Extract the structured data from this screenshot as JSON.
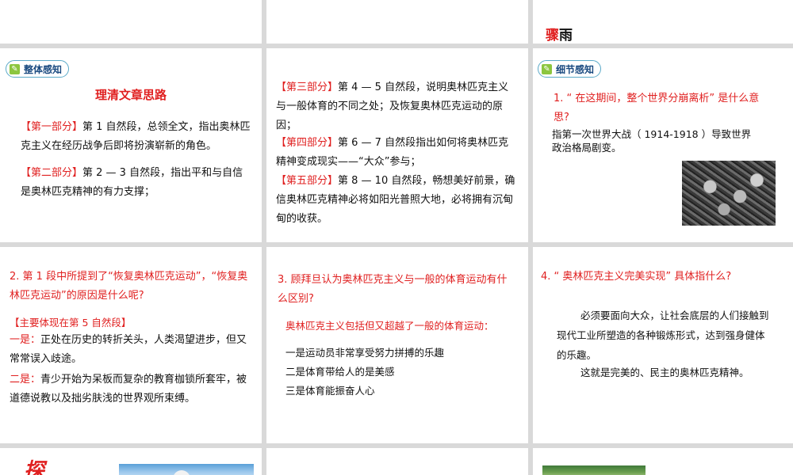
{
  "top": {
    "right_title_red": "骤",
    "right_title_dark": "雨"
  },
  "slide1": {
    "badge": "整体感知",
    "heading": "理清文章思路",
    "p1_tag": "【第一部分】",
    "p1_text": "第 1 自然段，总领全文，指出奥林匹克主义在经历战争后即将扮演崭新的角色。",
    "p2_tag": "【第二部分】",
    "p2_text": "第 2 — 3 自然段，指出平和与自信是奥林匹克精神的有力支撑；"
  },
  "slide2": {
    "p3_tag": "【第三部分】",
    "p3_text": "第 4 — 5 自然段，说明奥林匹克主义与一般体育的不同之处；及恢复奥林匹克运动的原因；",
    "p4_tag": "【第四部分】",
    "p4_text": "第 6 — 7 自然段指出如何将奥林匹克精神变成现实——“大众”参与；",
    "p5_tag": "【第五部分】",
    "p5_text": "第 8 — 10 自然段，畅想美好前景，确信奥林匹克精神必将如阳光普照大地，必将拥有沉甸甸的收获。"
  },
  "slide3": {
    "badge": "细节感知",
    "question": "1. “ 在这期间，整个世界分崩离析” 是什么意思?",
    "answer": "指第一次世界大战（ 1914-1918 ）导致世界政治格局剧变。"
  },
  "slide4": {
    "question": "2. 第 1 段中所提到了“恢复奥林匹克运动”，“恢复奥林匹克运动”的原因是什么呢?",
    "sub": "【主要体现在第 5 自然段】",
    "item1_tag": "一是：",
    "item1_text": "正处在历史的转折关头，人类渴望进步，但又常常误入歧途。",
    "item2_tag": "二是：",
    "item2_text": "青少开始为呆板而复杂的教育枷锁所套牢，被道德说教以及拙劣肤浅的世界观所束缚。"
  },
  "slide5": {
    "question": "3. 顾拜旦认为奥林匹克主义与一般的体育运动有什么区别?",
    "lead": "奥林匹克主义包括但又超越了一般的体育运动：",
    "items": [
      "一是运动员非常享受努力拼搏的乐趣",
      "二是体育带给人的是美感",
      "三是体育能振奋人心"
    ]
  },
  "slide6": {
    "question": "4. “ 奥林匹克主义完美实现” 具体指什么?",
    "answer1": "必须要面向大众，让社会底层的人们接触到现代工业所塑造的各种锻炼形式，达到强身健体的乐趣。",
    "answer2": "这就是完美的、民主的奥林匹克精神。"
  },
  "bottom": {
    "left_partial": "探"
  }
}
